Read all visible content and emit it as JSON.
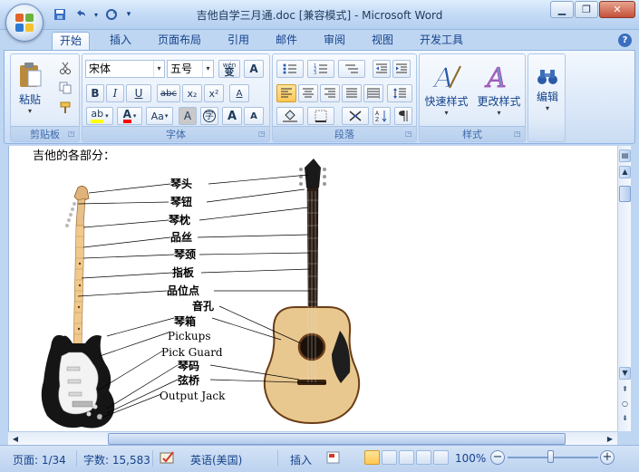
{
  "window": {
    "title": "吉他自学三月通.doc [兼容模式] - Microsoft Word"
  },
  "ribbon_tabs": [
    "开始",
    "插入",
    "页面布局",
    "引用",
    "邮件",
    "审阅",
    "视图",
    "开发工具"
  ],
  "clipboard": {
    "paste_label": "粘贴",
    "group_label": "剪贴板"
  },
  "font": {
    "name": "宋体",
    "size": "五号",
    "wen_label": "wén\n变",
    "btn_A": "A",
    "bold": "B",
    "italic": "I",
    "underline": "U",
    "strike": "abc",
    "subscript": "x₂",
    "superscript": "x²",
    "clear_label": "A",
    "highlight": "ab",
    "color": "A",
    "case": "Aa",
    "char_shade": "A",
    "enclose": "字",
    "grow": "A",
    "shrink": "A",
    "group_label": "字体"
  },
  "paragraph": {
    "group_label": "段落"
  },
  "styles": {
    "quick_label": "快速样式",
    "change_label": "更改样式",
    "group_label": "样式"
  },
  "editing": {
    "label": "编辑"
  },
  "document": {
    "heading": "吉他的各部分：",
    "labels": {
      "headstock": "琴头",
      "tuner": "琴钮",
      "nut": "琴枕",
      "fret": "品丝",
      "neck": "琴颈",
      "fingerboard": "指板",
      "fret_marker": "品位点",
      "soundhole": "音孔",
      "body": "琴箱",
      "pickups": "Pickups",
      "pickguard": "Pick Guard",
      "bridge": "琴码",
      "saddle": "弦桥",
      "output_jack": "Output Jack"
    }
  },
  "status": {
    "page": "页面: 1/34",
    "words": "字数: 15,583",
    "language": "英语(美国)",
    "insert_mode": "插入",
    "zoom": "100%"
  }
}
